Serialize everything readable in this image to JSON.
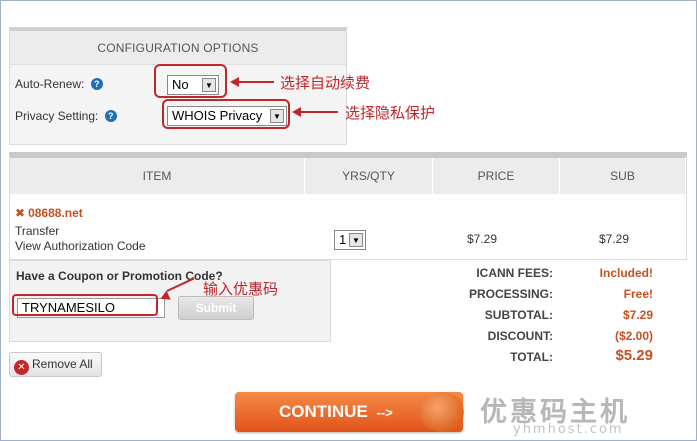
{
  "config": {
    "heading": "CONFIGURATION OPTIONS",
    "auto_renew_label": "Auto-Renew:",
    "auto_renew_value": "No",
    "privacy_label": "Privacy Setting:",
    "privacy_value": "WHOIS Privacy",
    "help_glyph": "?"
  },
  "annotations": {
    "auto_renew_note": "选择自动续费",
    "privacy_note": "选择隐私保护",
    "coupon_note": "输入优惠码"
  },
  "table": {
    "headers": [
      "ITEM",
      "YRS/QTY",
      "PRICE",
      "SUB"
    ],
    "domain": "08688.net",
    "item_type": "Transfer",
    "auth_link": "View Authorization Code",
    "qty": "1",
    "price": "$7.29",
    "sub": "$7.29"
  },
  "coupon": {
    "title": "Have a Coupon or Promotion Code?",
    "code": "TRYNAMESILO",
    "submit_label": "Submit"
  },
  "totals": {
    "icann_label": "ICANN FEES:",
    "icann_value": "Included!",
    "processing_label": "PROCESSING:",
    "processing_value": "Free!",
    "subtotal_label": "SUBTOTAL:",
    "subtotal_value": "$7.29",
    "discount_label": "DISCOUNT:",
    "discount_value": "($2.00)",
    "total_label": "TOTAL:",
    "total_value": "$5.29"
  },
  "actions": {
    "remove_all_label": "Remove All",
    "continue_label": "CONTINUE",
    "continue_arrow": "-->"
  },
  "watermark": {
    "cn": "优惠码主机",
    "en": "yhmhost.com"
  },
  "colors": {
    "accent": "#c8501f",
    "annotation_red": "#c0272d",
    "continue_orange": "#e2531c"
  }
}
